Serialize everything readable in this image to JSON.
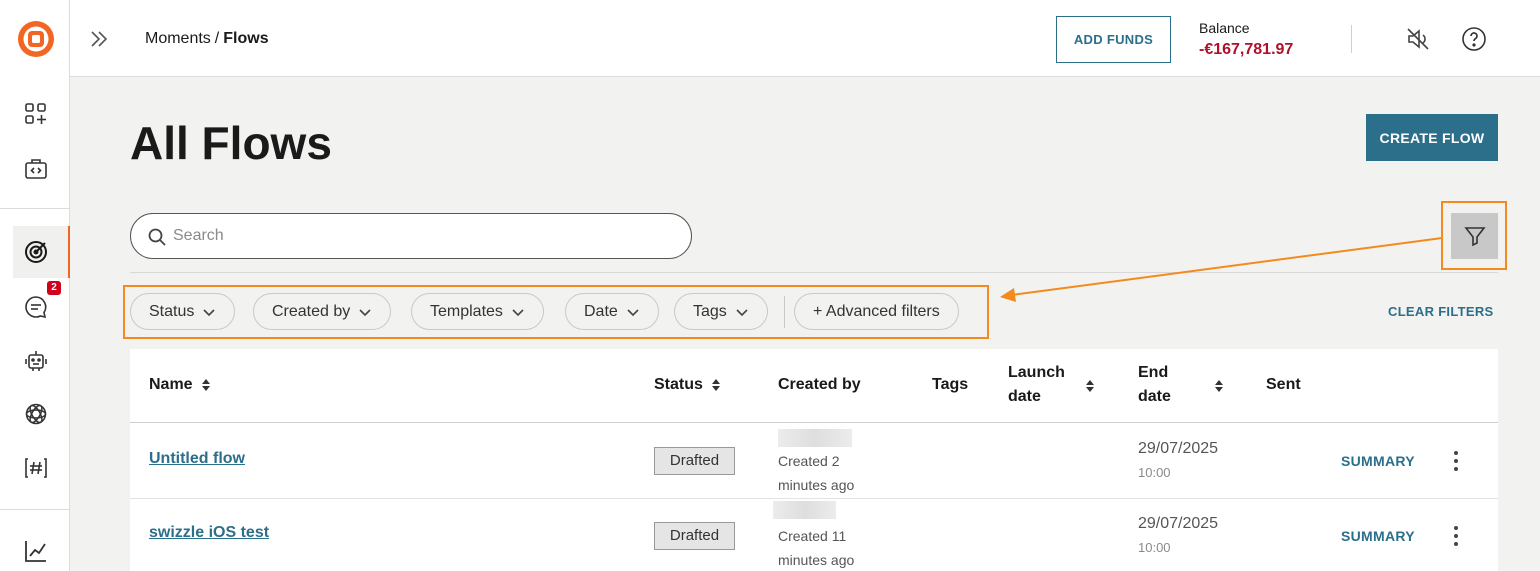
{
  "header": {
    "breadcrumb": {
      "parent": "Moments",
      "separator": "/",
      "current": "Flows"
    },
    "add_funds_label": "ADD FUNDS",
    "balance_label": "Balance",
    "balance_value": "-€167,781.97"
  },
  "sidebar": {
    "badge_count": "2",
    "icons": [
      "dashboard-add-icon",
      "code-briefcase-icon",
      "target-icon",
      "chat-icon",
      "robot-icon",
      "openai-icon",
      "hash-code-icon",
      "analytics-icon"
    ]
  },
  "main": {
    "title": "All Flows",
    "create_flow_label": "CREATE FLOW",
    "search": {
      "placeholder": "Search",
      "value": ""
    },
    "filters": [
      {
        "label": "Status"
      },
      {
        "label": "Created by"
      },
      {
        "label": "Templates"
      },
      {
        "label": "Date"
      },
      {
        "label": "Tags"
      }
    ],
    "advanced_filters_label": "+ Advanced filters",
    "clear_filters_label": "CLEAR FILTERS"
  },
  "table": {
    "columns": {
      "name": "Name",
      "status": "Status",
      "created_by": "Created by",
      "tags": "Tags",
      "launch_date_1": "Launch",
      "launch_date_2": "date",
      "end_date_1": "End",
      "end_date_2": "date",
      "sent": "Sent"
    },
    "rows": [
      {
        "name": "Untitled flow",
        "status": "Drafted",
        "created_1": "Created 2",
        "created_2": "minutes ago",
        "end_date": "29/07/2025",
        "end_time": "10:00",
        "action": "SUMMARY"
      },
      {
        "name": "swizzle iOS test",
        "status": "Drafted",
        "created_1": "Created 11",
        "created_2": "minutes ago",
        "end_date": "29/07/2025",
        "end_time": "10:00",
        "action": "SUMMARY"
      }
    ]
  },
  "colors": {
    "accent": "#2b6f8b",
    "highlight": "#f28a1d",
    "balance_negative": "#b0102a",
    "brand": "#f26522"
  }
}
